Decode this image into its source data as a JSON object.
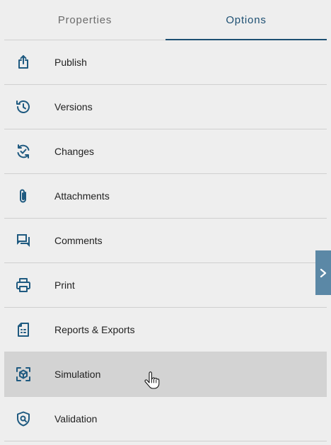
{
  "tabs": [
    {
      "label": "Properties",
      "active": false
    },
    {
      "label": "Options",
      "active": true
    }
  ],
  "menu": {
    "items": [
      {
        "label": "Publish",
        "icon": "publish-icon"
      },
      {
        "label": "Versions",
        "icon": "history-icon"
      },
      {
        "label": "Changes",
        "icon": "changes-icon"
      },
      {
        "label": "Attachments",
        "icon": "paperclip-icon"
      },
      {
        "label": "Comments",
        "icon": "comments-icon"
      },
      {
        "label": "Print",
        "icon": "printer-icon"
      },
      {
        "label": "Reports & Exports",
        "icon": "report-icon"
      },
      {
        "label": "Simulation",
        "icon": "simulation-icon",
        "hovered": true
      },
      {
        "label": "Validation",
        "icon": "shield-search-icon"
      }
    ]
  },
  "side_toggle": {
    "icon": "chevron-right-icon"
  },
  "colors": {
    "accent": "#1d4f72",
    "icon": "#1f5a80",
    "background": "#eeeeee",
    "hover": "#d3d3d3",
    "toggle": "#5b88a6"
  }
}
